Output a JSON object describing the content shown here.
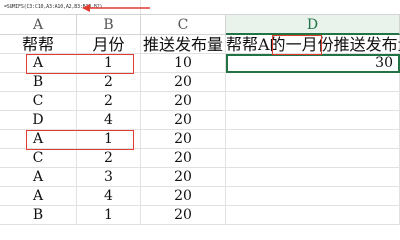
{
  "formula_bar": {
    "formula": "=SUMIFS(C3:C10,A3:A10,A2,B3:B10,B2)"
  },
  "columns": [
    "A",
    "B",
    "C",
    "D"
  ],
  "header_row": {
    "a": "帮帮",
    "b": "月份",
    "c": "推送发布量",
    "d_prefix": "帮帮A的",
    "d_highlight": "一月份",
    "d_suffix": "推送发布量"
  },
  "rows": [
    {
      "a": "A",
      "b": "1",
      "c": "10",
      "d": "30"
    },
    {
      "a": "B",
      "b": "2",
      "c": "20",
      "d": ""
    },
    {
      "a": "C",
      "b": "2",
      "c": "20",
      "d": ""
    },
    {
      "a": "D",
      "b": "4",
      "c": "20",
      "d": ""
    },
    {
      "a": "A",
      "b": "1",
      "c": "20",
      "d": ""
    },
    {
      "a": "C",
      "b": "2",
      "c": "20",
      "d": ""
    },
    {
      "a": "A",
      "b": "3",
      "c": "20",
      "d": ""
    },
    {
      "a": "A",
      "b": "4",
      "c": "20",
      "d": ""
    },
    {
      "a": "B",
      "b": "1",
      "c": "20",
      "d": ""
    }
  ],
  "colors": {
    "accent_green": "#217346",
    "highlight_red": "#e03c31"
  }
}
